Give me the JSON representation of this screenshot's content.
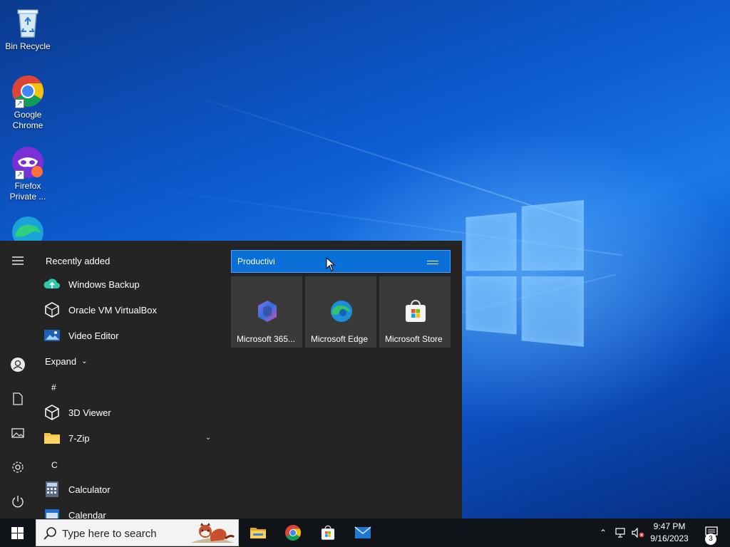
{
  "desktop": {
    "icons": [
      {
        "label": "Bin Recycle",
        "icon": "recycle-bin-icon"
      },
      {
        "label": "Google\nChrome",
        "icon": "chrome-icon"
      },
      {
        "label": "Firefox\nPrivate ...",
        "icon": "firefox-private-icon"
      },
      {
        "label": "",
        "icon": "edge-icon"
      }
    ]
  },
  "start_menu": {
    "recently_added_header": "Recently added",
    "recent_apps": [
      {
        "label": "Windows Backup",
        "icon": "windows-backup-icon"
      },
      {
        "label": "Oracle VM VirtualBox",
        "icon": "virtualbox-icon"
      },
      {
        "label": "Video Editor",
        "icon": "video-editor-icon"
      }
    ],
    "expand_label": "Expand",
    "sections": [
      {
        "letter": "#",
        "apps": [
          {
            "label": "3D Viewer",
            "icon": "3d-viewer-icon"
          },
          {
            "label": "7-Zip",
            "icon": "folder-icon",
            "expandable": true
          }
        ]
      },
      {
        "letter": "C",
        "apps": [
          {
            "label": "Calculator",
            "icon": "calculator-icon"
          },
          {
            "label": "Calendar",
            "icon": "calendar-icon"
          }
        ]
      }
    ],
    "rail": [
      "hamburger-icon",
      "user-icon",
      "documents-icon",
      "pictures-icon",
      "settings-icon",
      "power-icon"
    ],
    "tile_group": {
      "name_value": "Productivi",
      "tiles": [
        {
          "label": "Microsoft 365...",
          "icon": "microsoft-365-icon"
        },
        {
          "label": "Microsoft Edge",
          "icon": "edge-icon"
        },
        {
          "label": "Microsoft Store",
          "icon": "store-icon"
        }
      ]
    }
  },
  "taskbar": {
    "search_placeholder": "Type here to search",
    "pinned": [
      "file-explorer-icon",
      "chrome-icon",
      "store-icon",
      "mail-icon"
    ],
    "tray": {
      "time": "9:47 PM",
      "date": "9/16/2023",
      "notification_count": "3"
    }
  },
  "colors": {
    "accent": "#0a6fd6",
    "start_bg": "#242424",
    "taskbar_bg": "#101418"
  }
}
